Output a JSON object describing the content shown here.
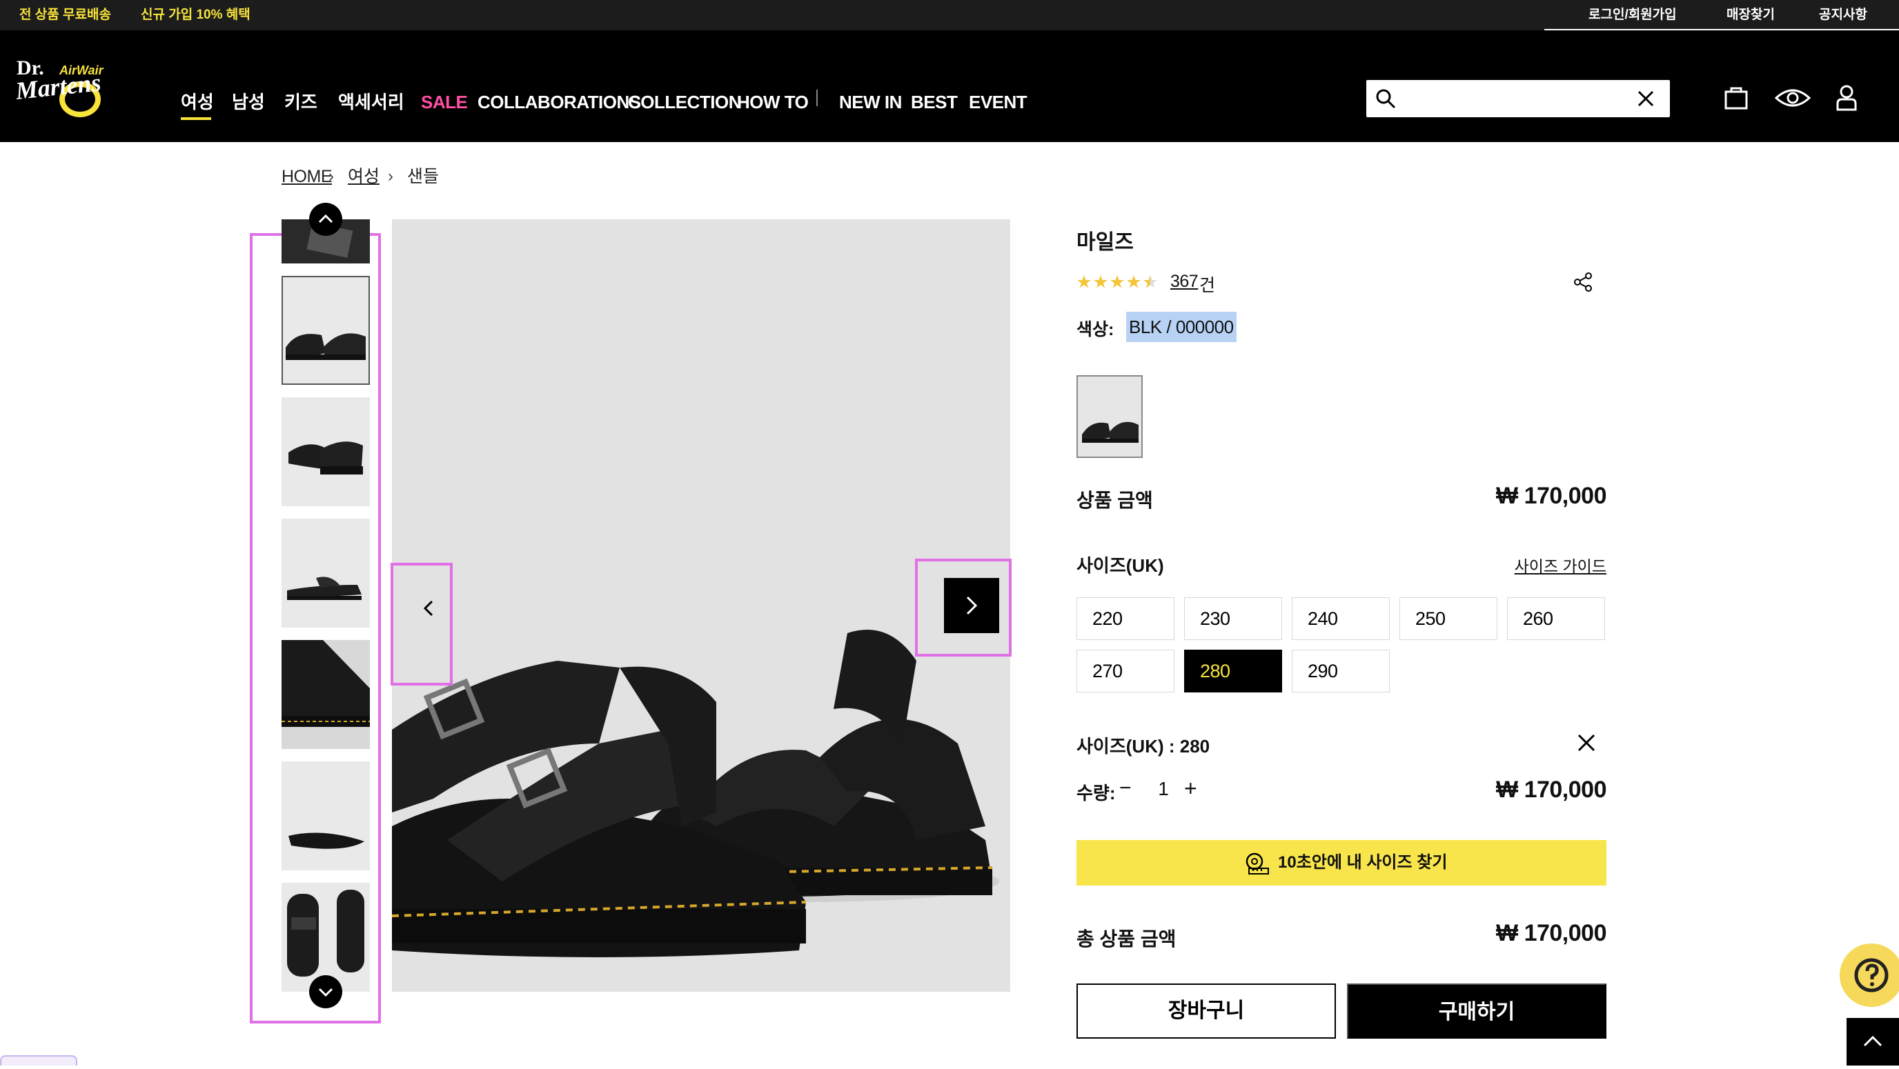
{
  "topbar": {
    "promo_free_shipping": "전 상품 무료배송",
    "promo_signup": "신규 가입 10% 혜택",
    "login": "로그인/회원가입",
    "store_finder": "매장찾기",
    "notice": "공지사항"
  },
  "nav": {
    "items": [
      {
        "label": "여성"
      },
      {
        "label": "남성"
      },
      {
        "label": "키즈"
      },
      {
        "label": "액세서리"
      },
      {
        "label": "SALE"
      },
      {
        "label": "COLLABORATIONS"
      },
      {
        "label": "COLLECTION"
      },
      {
        "label": "HOW TO"
      },
      {
        "label": "NEW IN"
      },
      {
        "label": "BEST"
      },
      {
        "label": "EVENT"
      }
    ],
    "active": "여성"
  },
  "search": {
    "placeholder": "",
    "value": ""
  },
  "breadcrumb": [
    "HOME",
    "여성",
    "샌들"
  ],
  "product": {
    "name": "마일즈",
    "rating": 4.5,
    "review_count": "367",
    "review_unit": "건",
    "color_label": "색상:",
    "color_value": "BLK / 000000",
    "price_label": "상품 금액",
    "price": "₩ 170,000",
    "size_label": "사이즈(UK)",
    "size_guide": "사이즈 가이드",
    "sizes": [
      "220",
      "230",
      "240",
      "250",
      "260",
      "270",
      "280",
      "290"
    ],
    "selected_size": "280",
    "selected_size_text": "사이즈(UK) : 280",
    "qty_label": "수량:",
    "qty_minus": "−",
    "qty_value": "1",
    "qty_plus": "+",
    "line_price": "₩ 170,000",
    "finder_label": "10초안에 내 사이즈 찾기",
    "total_label": "총 상품 금액",
    "total_price": "₩ 170,000",
    "cart_button": "장바구니",
    "buy_button": "구매하기"
  },
  "colors": {
    "accent_yellow": "#f7e33b",
    "sale_pink": "#ff4fa3",
    "highlight_magenta": "#e070e6",
    "header_bg": "#000000",
    "finder_bg": "#f8e44b"
  },
  "icons": [
    "search-icon",
    "close-icon",
    "bag-icon",
    "eye-icon",
    "user-icon",
    "share-icon",
    "chevron-up-icon",
    "chevron-down-icon",
    "chevron-left-icon",
    "chevron-right-icon",
    "ruler-icon",
    "help-icon"
  ]
}
